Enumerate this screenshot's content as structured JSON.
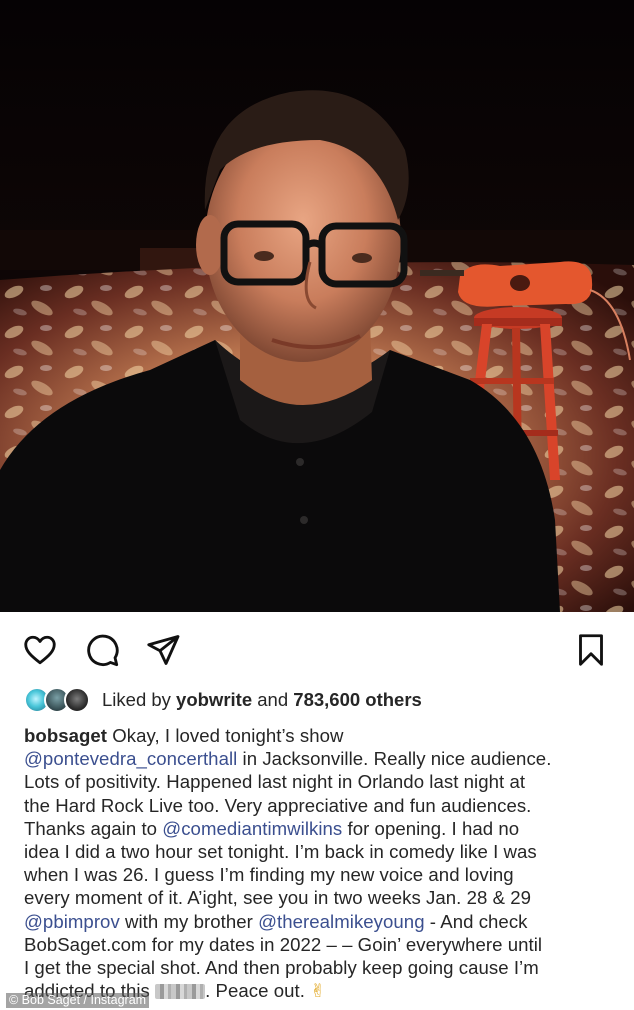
{
  "post": {
    "photo_alt": "Selfie of Bob Saget on a stage with a red stool and guitar",
    "actions": {
      "like_icon": "heart-icon",
      "comment_icon": "comment-bubble-icon",
      "share_icon": "paper-plane-icon",
      "save_icon": "bookmark-icon"
    },
    "likes": {
      "prefix": "Liked by",
      "user": "yobwrite",
      "conjunction": "and",
      "count": "783,600 others"
    },
    "caption": {
      "username": "bobsaget",
      "lines": [
        [
          {
            "t": "Okay, I loved tonight’s show"
          }
        ],
        [
          {
            "m": "@pontevedra_concerthall"
          },
          {
            "t": " in Jacksonville. Really nice audience."
          }
        ],
        [
          {
            "t": "Lots of positivity. Happened last night in Orlando last night at"
          }
        ],
        [
          {
            "t": "the Hard Rock Live too. Very appreciative and fun audiences."
          }
        ],
        [
          {
            "t": "Thanks again to "
          },
          {
            "m": "@comediantimwilkins"
          },
          {
            "t": " for opening. I had no"
          }
        ],
        [
          {
            "t": "idea I did a two hour set tonight. I’m back in comedy like I was"
          }
        ],
        [
          {
            "t": "when I was 26. I guess I’m finding my new voice and loving"
          }
        ],
        [
          {
            "t": "every moment of it. A’ight, see you in two weeks Jan. 28 & 29"
          }
        ],
        [
          {
            "m": "@pbimprov"
          },
          {
            "t": " with my brother "
          },
          {
            "m": "@therealmikeyoung"
          },
          {
            "t": " - And check"
          }
        ],
        [
          {
            "t": "BobSaget.com for my dates in 2022 – – Goin’ everywhere until"
          }
        ],
        [
          {
            "t": "I get the special shot. And then probably keep going cause I’m"
          }
        ],
        [
          {
            "t": "addicted to this "
          },
          {
            "blur": "shit"
          },
          {
            "t": ". Peace out. "
          },
          {
            "e": "✌"
          }
        ]
      ]
    },
    "credit": "© Bob Saget / Instagram"
  },
  "colors": {
    "mention": "#3b4f8f",
    "text": "#262626",
    "stool": "#d8442a",
    "guitar": "#e4572e"
  }
}
